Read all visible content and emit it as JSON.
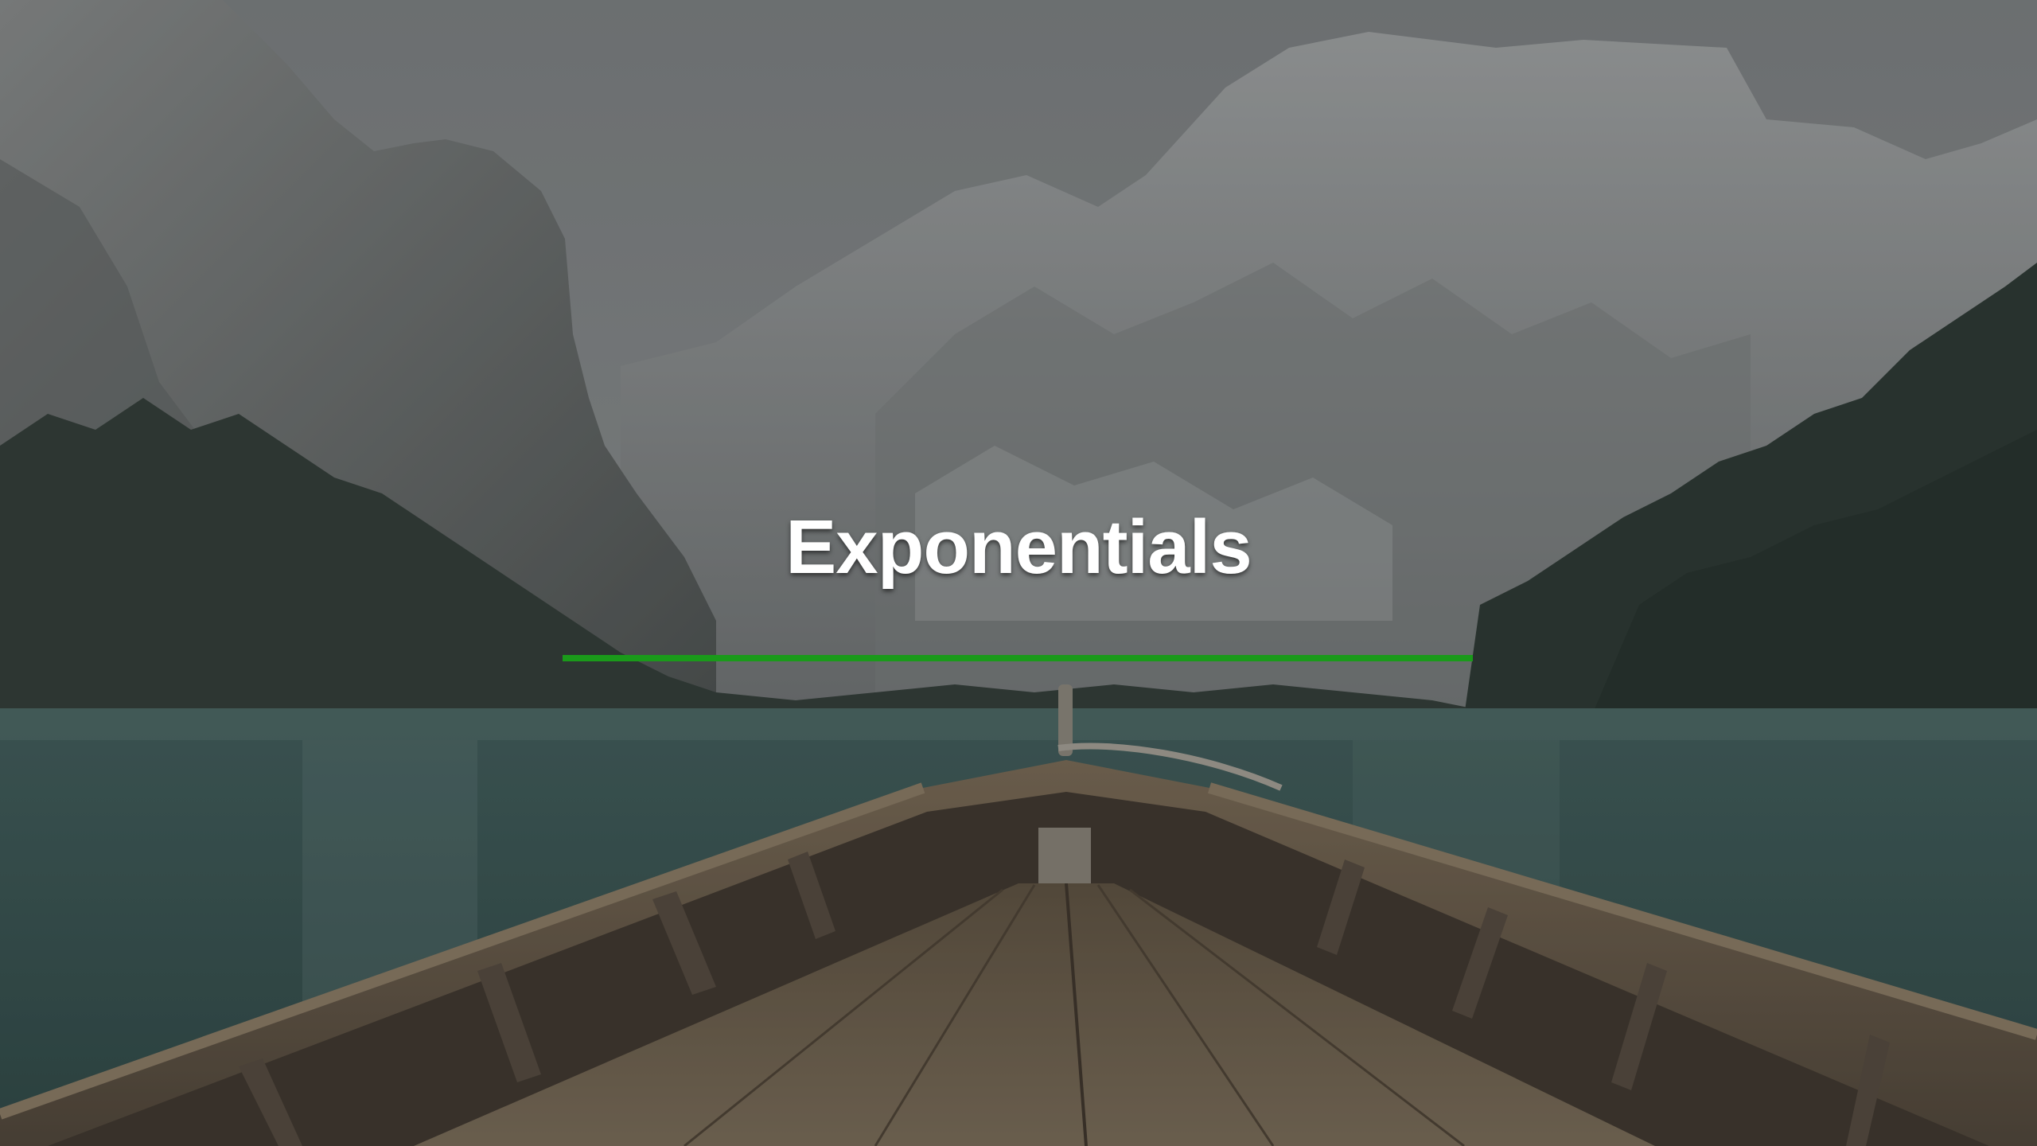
{
  "slide": {
    "title": "Exponentials",
    "slide_number": "",
    "background": "mountain-lake-boat-photo"
  },
  "colors": {
    "title_text": "#ffffff",
    "accent_rule": "#1a9a1a",
    "overlay": "#2e3233"
  }
}
